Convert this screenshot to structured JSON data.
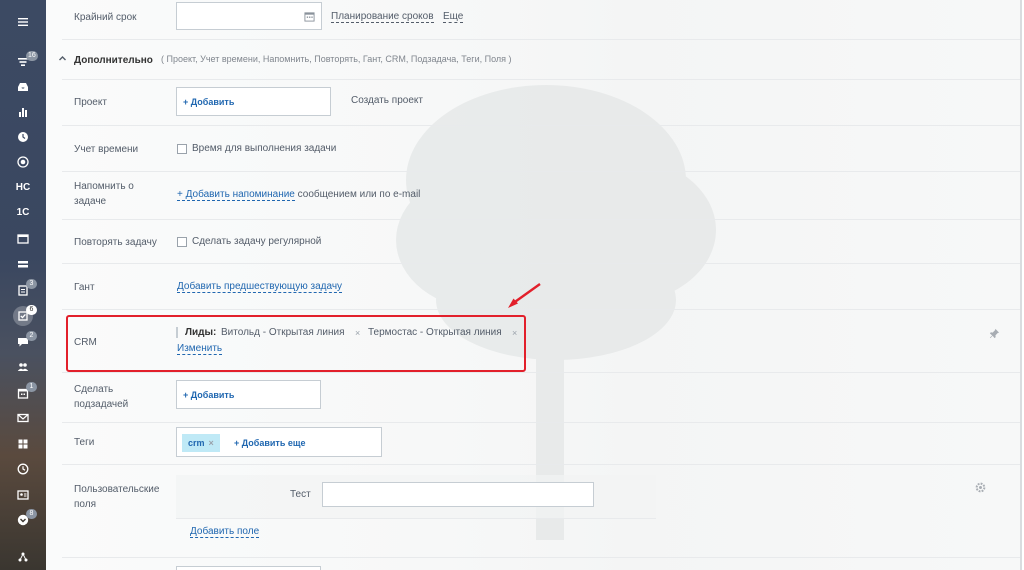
{
  "sidebar": {
    "items": [
      {
        "icon": "menu-icon"
      },
      {
        "icon": "filter-icon",
        "badge": "16"
      },
      {
        "icon": "inbox-icon"
      },
      {
        "icon": "bar-chart-icon"
      },
      {
        "icon": "clock-circle-icon"
      },
      {
        "icon": "target-icon"
      },
      {
        "label": "НС"
      },
      {
        "label": "1С"
      },
      {
        "icon": "window-icon"
      },
      {
        "icon": "drive-icon"
      },
      {
        "icon": "list-icon",
        "badge": "3"
      },
      {
        "icon": "tasks-icon",
        "badge": "6",
        "active": true
      },
      {
        "icon": "chat-icon",
        "badge": "2"
      },
      {
        "icon": "group-icon"
      },
      {
        "icon": "calendar-icon",
        "badge": "1"
      },
      {
        "icon": "mail-icon"
      },
      {
        "icon": "grid-icon"
      },
      {
        "icon": "time-icon"
      },
      {
        "icon": "contact-card-icon"
      },
      {
        "icon": "chevron-down-circle-icon",
        "badge": "8"
      },
      {
        "icon": "network-icon"
      }
    ]
  },
  "deadline": {
    "label": "Крайний срок",
    "planning_link": "Планирование сроков",
    "more_link": "Еще"
  },
  "additional": {
    "title": "Дополнительно",
    "items": "( Проект,  Учет времени,  Напомнить,  Повторять,  Гант,  CRM,  Подзадача,  Теги,  Поля )"
  },
  "project": {
    "label": "Проект",
    "add": "+ Добавить",
    "create_link": "Создать проект"
  },
  "time_tracking": {
    "label": "Учет времени",
    "checkbox_label": "Время для выполнения задачи"
  },
  "reminder": {
    "label": "Напомнить о задаче",
    "add_link": "+ Добавить напоминание",
    "suffix": "сообщением или по e-mail"
  },
  "repeat": {
    "label": "Повторять задачу",
    "checkbox_label": "Сделать задачу регулярной"
  },
  "gantt": {
    "label": "Гант",
    "add_link": "Добавить предшествующую задачу"
  },
  "crm": {
    "label": "CRM",
    "leads_label": "Лиды:",
    "leads": [
      "Витольд - Открытая линия",
      "Термостас - Открытая линия"
    ],
    "change_link": "Изменить"
  },
  "subtask": {
    "label": "Сделать подзадачей",
    "add": "+ Добавить"
  },
  "tags": {
    "label": "Теги",
    "tag": "crm",
    "add_more": "+ Добавить еще"
  },
  "custom_fields": {
    "label": "Пользовательские поля",
    "field_label": "Тест",
    "field_value": "",
    "add_field_link": "Добавить поле"
  },
  "colors": {
    "link": "#2067b0",
    "highlight": "#e2202b",
    "tag_bg": "#bfe9f6"
  }
}
